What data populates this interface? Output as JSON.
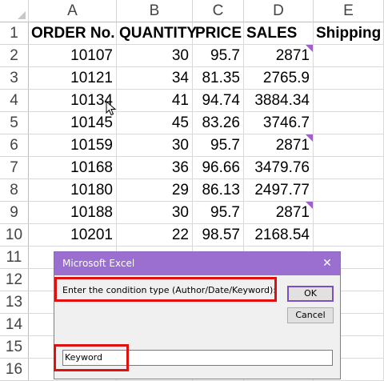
{
  "columns": [
    "A",
    "B",
    "C",
    "D",
    "E"
  ],
  "rows": [
    "1",
    "2",
    "3",
    "4",
    "5",
    "6",
    "7",
    "8",
    "9",
    "10",
    "11",
    "12",
    "13",
    "14",
    "15",
    "16"
  ],
  "headers": [
    "ORDER No.",
    "QUANTITY",
    "PRICE",
    "SALES",
    "Shipping"
  ],
  "data": [
    [
      "10107",
      "30",
      "95.7",
      "2871"
    ],
    [
      "10121",
      "34",
      "81.35",
      "2765.9"
    ],
    [
      "10134",
      "41",
      "94.74",
      "3884.34"
    ],
    [
      "10145",
      "45",
      "83.26",
      "3746.7"
    ],
    [
      "10159",
      "30",
      "95.7",
      "2871"
    ],
    [
      "10168",
      "36",
      "96.66",
      "3479.76"
    ],
    [
      "10180",
      "29",
      "86.13",
      "2497.77"
    ],
    [
      "10188",
      "30",
      "95.7",
      "2871"
    ],
    [
      "10201",
      "22",
      "98.57",
      "2168.54"
    ]
  ],
  "comment_rows": [
    0,
    4,
    7
  ],
  "dialog": {
    "title": "Microsoft Excel",
    "close": "✕",
    "prompt": "Enter the condition type (Author/Date/Keyword):",
    "ok_label": "OK",
    "cancel_label": "Cancel",
    "input_value": "Keyword"
  },
  "colors": {
    "dialog_title_bg": "#9a6fcf",
    "highlight": "#e01010",
    "comment_marker": "#a05fd0"
  }
}
